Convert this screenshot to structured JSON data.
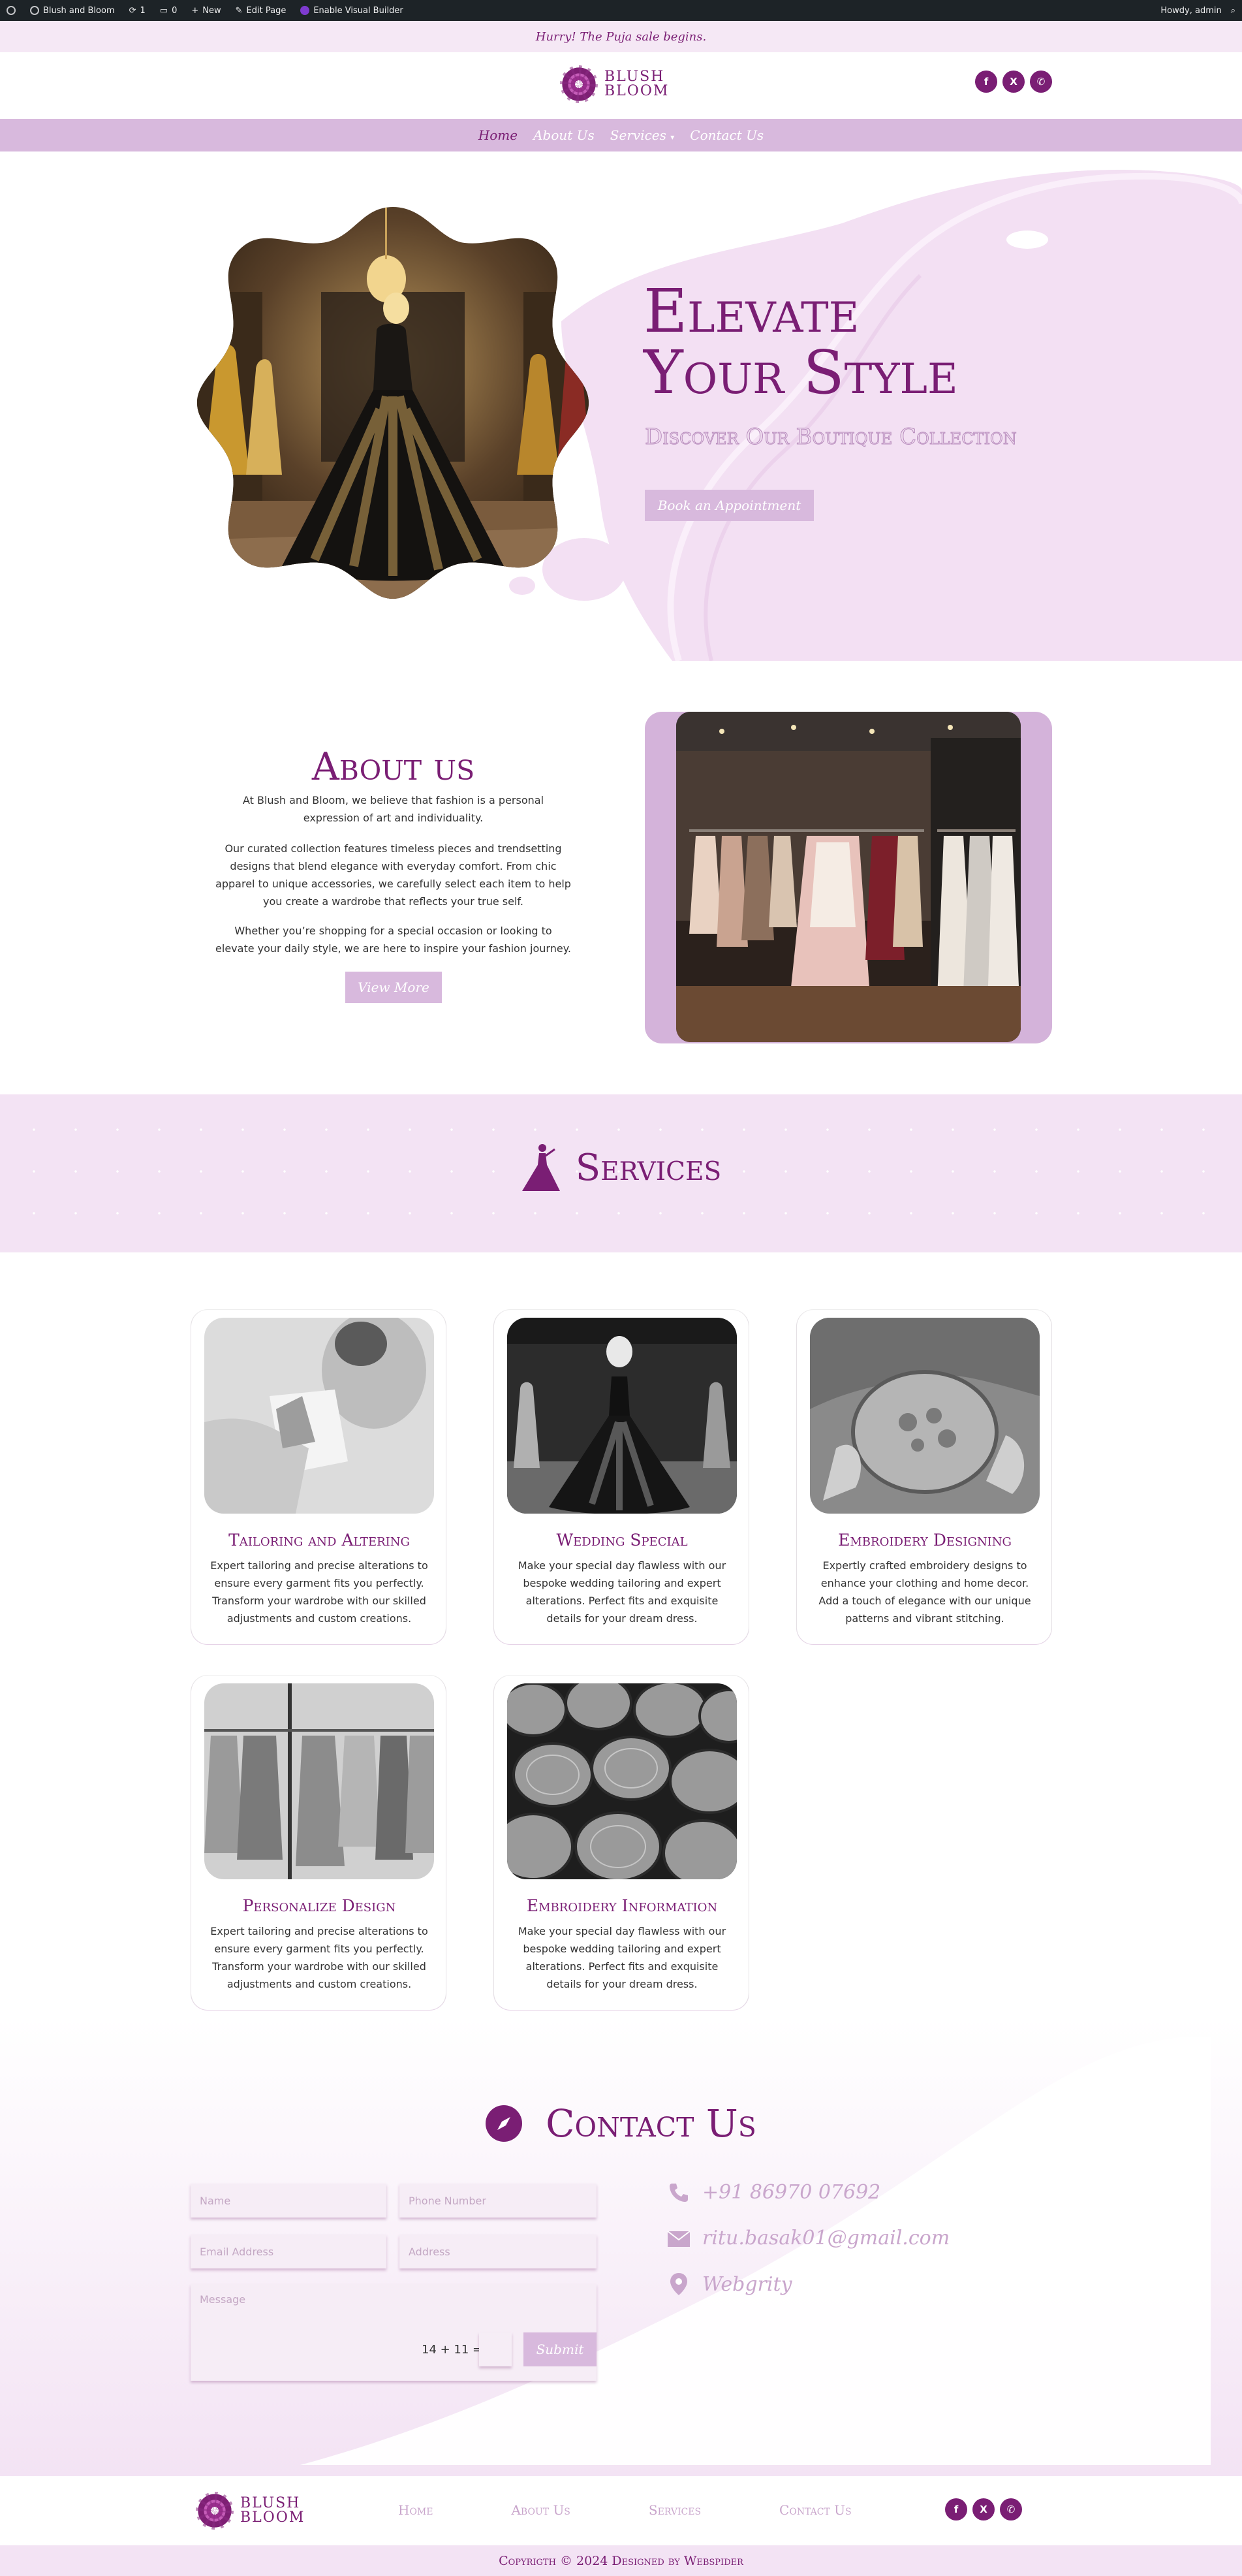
{
  "admin_bar": {
    "site_name": "Blush and Bloom",
    "updates_count": "1",
    "comments_count": "0",
    "new_label": "New",
    "edit_label": "Edit Page",
    "builder_label": "Enable Visual Builder",
    "greeting": "Howdy, admin"
  },
  "announcement": "Hurry! The Puja sale begins.",
  "logo": {
    "line1": "BLUSH",
    "line2": "BLOOM"
  },
  "socials": {
    "facebook": "f",
    "x": "X",
    "whatsapp": "✆"
  },
  "nav": {
    "home": "Home",
    "about": "About Us",
    "services": "Services",
    "contact": "Contact Us"
  },
  "hero": {
    "title_line1": "Elevate",
    "title_line2": "Your Style",
    "subtitle": "Discover Our Boutique Collection",
    "button": "Book an Appointment"
  },
  "about": {
    "title": "About us",
    "p1": "At Blush and Bloom, we believe that fashion is a personal expression of art and individuality.",
    "p2": "Our curated collection features timeless pieces and trendsetting designs that blend elegance with everyday comfort. From chic apparel to unique accessories, we carefully select each item to help you create a wardrobe that reflects your true self.",
    "p3": "Whether you’re shopping for a special occasion or looking to elevate your daily style, we are here to inspire your fashion journey.",
    "button": "View More"
  },
  "services": {
    "title": "Services",
    "cards": [
      {
        "title": "Tailoring and Altering",
        "text": "Expert tailoring and precise alterations to ensure every garment fits you perfectly. Transform your wardrobe with our skilled adjustments and custom creations."
      },
      {
        "title": "Wedding Special",
        "text": "Make your special day flawless with our bespoke wedding tailoring and expert alterations. Perfect fits and exquisite details for your dream dress."
      },
      {
        "title": "Embroidery Designing",
        "text": "Expertly crafted embroidery designs to enhance your clothing and home decor. Add a touch of elegance with our unique patterns and vibrant stitching."
      },
      {
        "title": "Personalize Design",
        "text": "Expert tailoring and precise alterations to ensure every garment fits you perfectly. Transform your wardrobe with our skilled adjustments and custom creations."
      },
      {
        "title": "Embroidery Information",
        "text": "Make your special day flawless with our bespoke wedding tailoring and expert alterations. Perfect fits and exquisite details for your dream dress."
      }
    ]
  },
  "contact": {
    "title": "Contact Us",
    "placeholders": {
      "name": "Name",
      "phone": "Phone Number",
      "email": "Email Address",
      "address": "Address",
      "message": "Message"
    },
    "captcha": "14 + 11 =",
    "submit": "Submit",
    "phone": "+91 86970 07692",
    "email": "ritu.basak01@gmail.com",
    "location": "Webgrity"
  },
  "footer": {
    "menu": {
      "home": "Home",
      "about": "About Us",
      "services": "Services",
      "contact": "Contact Us"
    },
    "copyright": "Copyrigth © 2024 Designed by Webspider"
  },
  "colors": {
    "brand": "#7a1e74",
    "lavender": "#d8b9dd",
    "blush_bg": "#f3e3f4",
    "admin_bar": "#1d2327"
  }
}
